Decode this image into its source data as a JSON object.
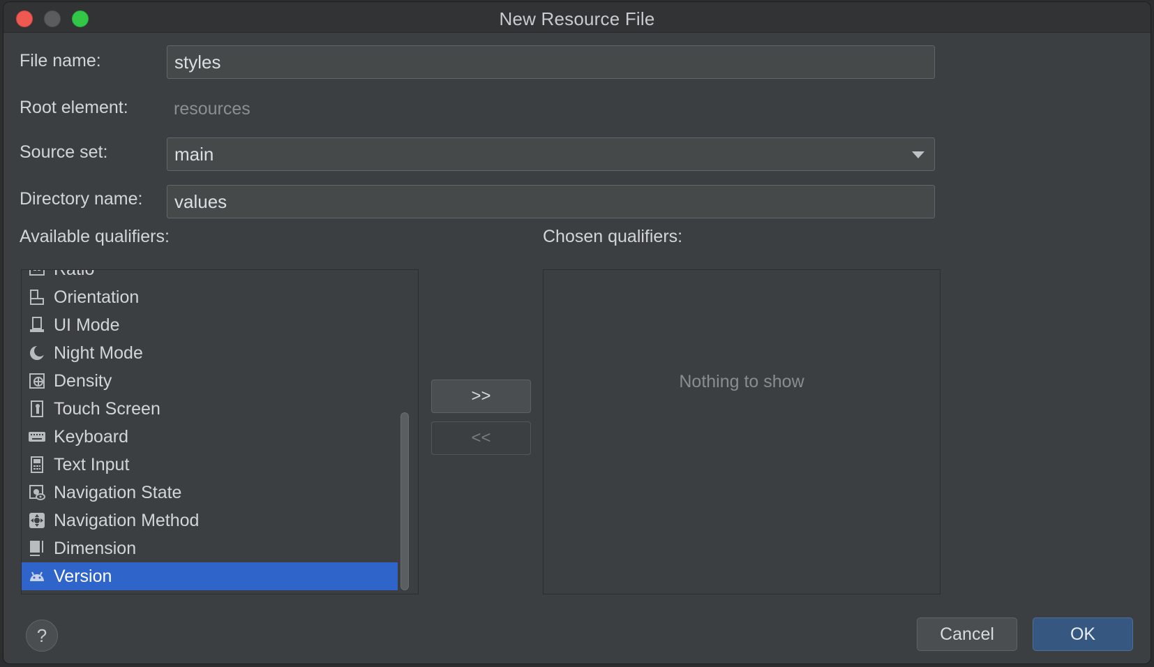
{
  "window": {
    "title": "New Resource File"
  },
  "form": {
    "file_name": {
      "label": "File name:",
      "value": "styles"
    },
    "root_element": {
      "label": "Root element:",
      "value": "resources"
    },
    "source_set": {
      "label": "Source set:",
      "value": "main"
    },
    "directory_name": {
      "label": "Directory name:",
      "value": "values"
    }
  },
  "available_qualifiers": {
    "label": "Available qualifiers:",
    "items": [
      {
        "label": "Ratio",
        "icon": "ratio-icon"
      },
      {
        "label": "Orientation",
        "icon": "orientation-icon"
      },
      {
        "label": "UI Mode",
        "icon": "ui-mode-icon"
      },
      {
        "label": "Night Mode",
        "icon": "night-mode-icon"
      },
      {
        "label": "Density",
        "icon": "density-icon"
      },
      {
        "label": "Touch Screen",
        "icon": "touch-screen-icon"
      },
      {
        "label": "Keyboard",
        "icon": "keyboard-icon"
      },
      {
        "label": "Text Input",
        "icon": "text-input-icon"
      },
      {
        "label": "Navigation State",
        "icon": "navigation-state-icon"
      },
      {
        "label": "Navigation Method",
        "icon": "navigation-method-icon"
      },
      {
        "label": "Dimension",
        "icon": "dimension-icon"
      },
      {
        "label": "Version",
        "icon": "android-version-icon",
        "selected": true
      }
    ]
  },
  "move_buttons": {
    "add": ">>",
    "remove": "<<"
  },
  "chosen_qualifiers": {
    "label": "Chosen qualifiers:",
    "empty_text": "Nothing to show"
  },
  "footer": {
    "help": "?",
    "cancel": "Cancel",
    "ok": "OK"
  },
  "colors": {
    "selection": "#2f65ca",
    "ok_button": "#365880",
    "close": "#ee5a52",
    "maximize": "#33c748"
  }
}
